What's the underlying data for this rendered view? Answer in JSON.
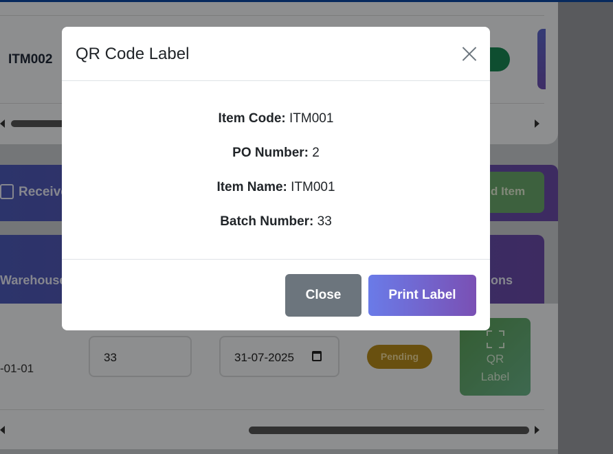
{
  "background": {
    "top_row_item_code": "ITM002",
    "top_row_badge": "n",
    "receive_button_label": "Receive",
    "add_item_button_label": "d Item",
    "warehouse_header": "Warehouse",
    "actions_header": "ons",
    "row_date_left": "-01-01",
    "row_quantity_value": "33",
    "row_date_value": "31-07-2025",
    "row_status_badge": "Pending",
    "qr_button_line1": "QR",
    "qr_button_line2": "Label"
  },
  "modal": {
    "title": "QR Code Label",
    "fields": [
      {
        "label": "Item Code:",
        "value": "ITM001"
      },
      {
        "label": "PO Number:",
        "value": "2"
      },
      {
        "label": "Item Name:",
        "value": "ITM001"
      },
      {
        "label": "Batch Number:",
        "value": "33"
      }
    ],
    "close_button_label": "Close",
    "print_button_label": "Print Label"
  },
  "icons": [
    "close-icon",
    "checkbox-icon",
    "calendar-icon",
    "qr-scan-icon",
    "scroll-left-icon",
    "scroll-right-icon"
  ],
  "colors": {
    "primary_gradient_start": "#6a7be8",
    "primary_gradient_end": "#7a50b4",
    "secondary": "#6c757d",
    "success": "#198754",
    "warning": "#b58a1b"
  }
}
